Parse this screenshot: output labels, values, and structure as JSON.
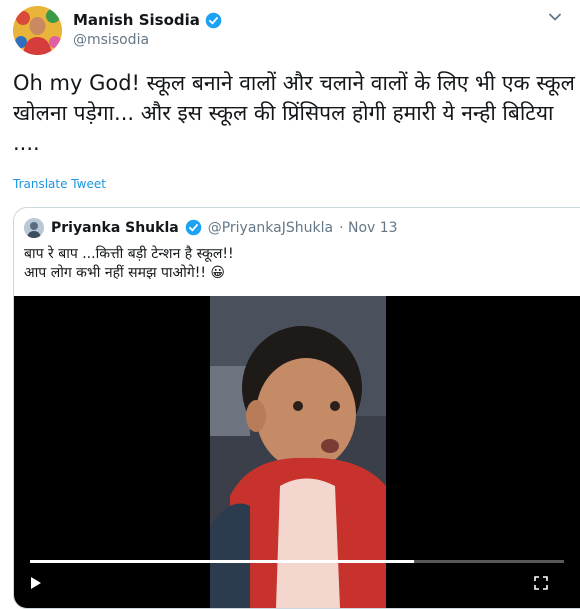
{
  "tweet": {
    "author_name": "Manish Sisodia",
    "handle": "@msisodia",
    "text": "Oh my God! स्कूल बनाने वालों और चलाने वालों के लिए भी एक स्कूल खोलना पड़ेगा... और इस स्कूल की प्रिंसिपल होगी हमारी ये नन्ही बिटिया ....",
    "translate_label": "Translate Tweet"
  },
  "quoted": {
    "author_name": "Priyanka Shukla",
    "handle": "@PriyankaJShukla",
    "date": "· Nov 13",
    "text_line1": "बाप रे बाप ...कित्ती बड़ी टेन्शन है स्कूल!!",
    "text_line2": "आप लोग कभी नहीं समझ पाओगे!! 😀"
  },
  "video": {
    "progress_percent": 72
  },
  "colors": {
    "link": "#1b95e0",
    "verified": "#1da1f2",
    "secondary_text": "#657786",
    "border": "#ccd6dd"
  }
}
